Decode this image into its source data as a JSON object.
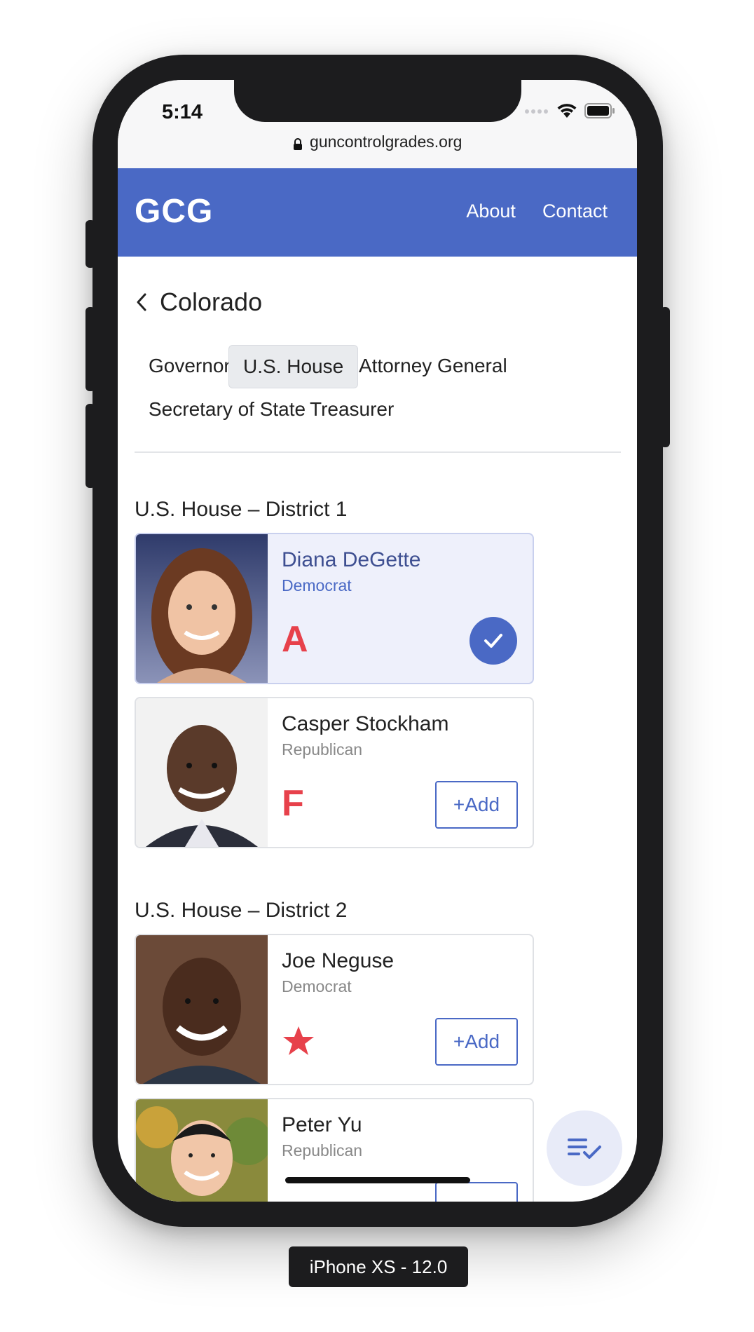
{
  "status_bar": {
    "time": "5:14"
  },
  "browser": {
    "url": "guncontrolgrades.org"
  },
  "header": {
    "logo": "GCG",
    "nav": [
      "About",
      "Contact"
    ]
  },
  "page": {
    "state": "Colorado"
  },
  "tabs": [
    {
      "label": "Governor",
      "active": false
    },
    {
      "label": "U.S. House",
      "active": true
    },
    {
      "label": "Attorney General",
      "active": false
    },
    {
      "label": "Secretary of State",
      "active": false
    },
    {
      "label": "Treasurer",
      "active": false
    }
  ],
  "districts": [
    {
      "title": "U.S. House – District 1",
      "candidates": [
        {
          "name": "Diana DeGette",
          "party": "Democrat",
          "grade": "A",
          "added": true
        },
        {
          "name": "Casper Stockham",
          "party": "Republican",
          "grade": "F",
          "added": false,
          "action": "+Add"
        }
      ]
    },
    {
      "title": "U.S. House – District 2",
      "candidates": [
        {
          "name": "Joe Neguse",
          "party": "Democrat",
          "grade": "star",
          "added": false,
          "action": "+Add"
        },
        {
          "name": "Peter Yu",
          "party": "Republican",
          "added": false
        }
      ]
    }
  ],
  "device_label": "iPhone XS - 12.0",
  "colors": {
    "brand": "#4a69c5",
    "grade": "#e7414b",
    "selected_bg": "#eef0fb"
  },
  "icons": {
    "back": "chevron-left-icon",
    "fab": "playlist-check-icon",
    "check": "check-icon",
    "star": "star-icon"
  }
}
